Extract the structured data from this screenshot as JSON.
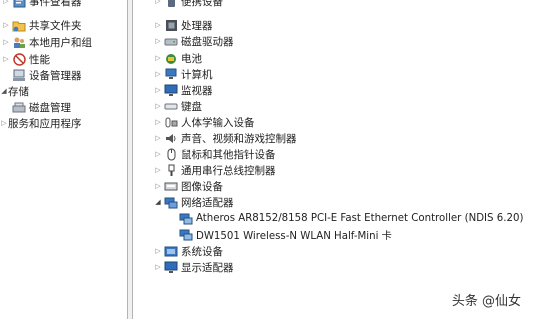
{
  "left_tree": {
    "items": [
      {
        "label": "事件查看器"
      },
      {
        "label": "共享文件夹"
      },
      {
        "label": "本地用户和组"
      },
      {
        "label": "性能"
      },
      {
        "label": "设备管理器"
      },
      {
        "label": "存储"
      },
      {
        "label": "磁盘管理"
      },
      {
        "label": "服务和应用程序"
      }
    ]
  },
  "device_tree": {
    "items": [
      {
        "label": "便携设备",
        "icon": "portable-device-icon"
      },
      {
        "label": "处理器",
        "icon": "processor-icon"
      },
      {
        "label": "磁盘驱动器",
        "icon": "disk-drive-icon"
      },
      {
        "label": "电池",
        "icon": "battery-icon"
      },
      {
        "label": "计算机",
        "icon": "computer-icon"
      },
      {
        "label": "监视器",
        "icon": "monitor-icon"
      },
      {
        "label": "键盘",
        "icon": "keyboard-icon"
      },
      {
        "label": "人体学输入设备",
        "icon": "hid-icon"
      },
      {
        "label": "声音、视频和游戏控制器",
        "icon": "sound-icon"
      },
      {
        "label": "鼠标和其他指针设备",
        "icon": "mouse-icon"
      },
      {
        "label": "通用串行总线控制器",
        "icon": "usb-icon"
      },
      {
        "label": "图像设备",
        "icon": "imaging-icon"
      },
      {
        "label": "网络适配器",
        "icon": "network-adapter-icon",
        "expanded": true
      },
      {
        "label": "系统设备",
        "icon": "system-device-icon"
      },
      {
        "label": "显示适配器",
        "icon": "display-adapter-icon"
      }
    ],
    "network_children": [
      {
        "label": "Atheros AR8152/8158 PCI-E Fast Ethernet Controller (NDIS 6.20)"
      },
      {
        "label": "DW1501 Wireless-N WLAN Half-Mini 卡"
      }
    ]
  },
  "watermark": "头条 @仙女",
  "colors": {
    "splitter": "#f0f0f0",
    "border": "#b4b4b4",
    "text": "#222222"
  }
}
